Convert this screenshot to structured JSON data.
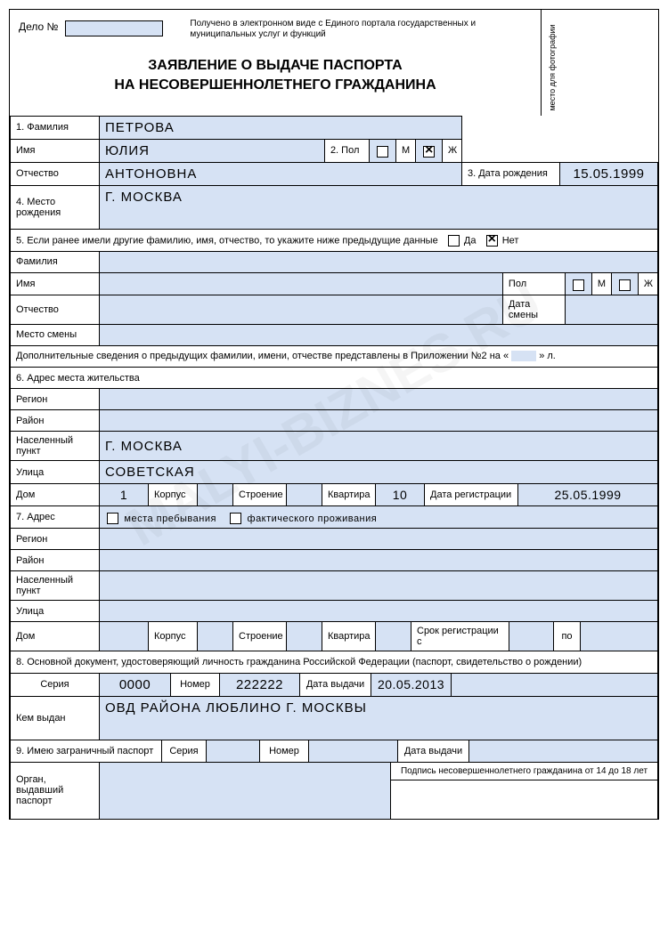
{
  "header": {
    "delo_label": "Дело №",
    "note": "Получено в электронном виде с Единого портала государственных и муниципальных услуг и функций",
    "photo_label": "место для фотографии",
    "title_line1": "ЗАЯВЛЕНИЕ О ВЫДАЧЕ ПАСПОРТА",
    "title_line2": "НА НЕСОВЕРШЕННОЛЕТНЕГО ГРАЖДАНИНА"
  },
  "s1": {
    "lbl_surname": "1. Фамилия",
    "surname": "ПЕТРОВА",
    "lbl_name": "Имя",
    "name": "ЮЛИЯ",
    "lbl_gender": "2. Пол",
    "lbl_m": "М",
    "lbl_f": "Ж",
    "lbl_patronymic": "Отчество",
    "patronymic": "АНТОНОВНА",
    "lbl_dob": "3. Дата рождения",
    "dob": "15.05.1999",
    "lbl_pob": "4. Место рождения",
    "pob": "Г. МОСКВА"
  },
  "s5": {
    "heading": "5. Если ранее имели другие фамилию, имя, отчество, то укажите ниже предыдущие данные",
    "lbl_yes": "Да",
    "lbl_no": "Нет",
    "lbl_surname": "Фамилия",
    "lbl_name": "Имя",
    "lbl_gender": "Пол",
    "lbl_m": "М",
    "lbl_f": "Ж",
    "lbl_patronymic": "Отчество",
    "lbl_change_date": "Дата смены",
    "lbl_change_place": "Место смены",
    "appendix_before": "Дополнительные сведения о предыдущих фамилии, имени, отчестве представлены в Приложении №2 на «",
    "appendix_after": "» л."
  },
  "s6": {
    "heading": "6. Адрес места жительства",
    "lbl_region": "Регион",
    "lbl_district": "Район",
    "lbl_city": "Населенный пункт",
    "city": "Г. МОСКВА",
    "lbl_street": "Улица",
    "street": "СОВЕТСКАЯ",
    "lbl_house": "Дом",
    "house": "1",
    "lbl_korpus": "Корпус",
    "lbl_stroenie": "Строение",
    "lbl_flat": "Квартира",
    "flat": "10",
    "lbl_regdate": "Дата регистрации",
    "regdate": "25.05.1999"
  },
  "s7": {
    "lbl": "7. Адрес",
    "lbl_stay": "места пребывания",
    "lbl_actual": "фактического проживания",
    "lbl_region": "Регион",
    "lbl_district": "Район",
    "lbl_city": "Населенный пункт",
    "lbl_street": "Улица",
    "lbl_house": "Дом",
    "lbl_korpus": "Корпус",
    "lbl_stroenie": "Строение",
    "lbl_flat": "Квартира",
    "lbl_regperiod": "Срок регистрации с",
    "lbl_to": "по"
  },
  "s8": {
    "heading": "8. Основной документ, удостоверяющий личность гражданина Российской Федерации (паспорт, свидетельство о рождении)",
    "lbl_series": "Серия",
    "series": "0000",
    "lbl_number": "Номер",
    "number": "222222",
    "lbl_issue_date": "Дата выдачи",
    "issue_date": "20.05.2013",
    "lbl_issued_by": "Кем выдан",
    "issued_by": "ОВД РАЙОНА ЛЮБЛИНО Г. МОСКВЫ"
  },
  "s9": {
    "heading": "9. Имею заграничный паспорт",
    "lbl_series": "Серия",
    "lbl_number": "Номер",
    "lbl_issue_date": "Дата выдачи",
    "lbl_issued_by": "Орган, выдавший паспорт",
    "signature_note": "Подпись несовершеннолетнего гражданина от 14 до 18 лет"
  },
  "watermark": "MALYI-BIZNES.RU"
}
